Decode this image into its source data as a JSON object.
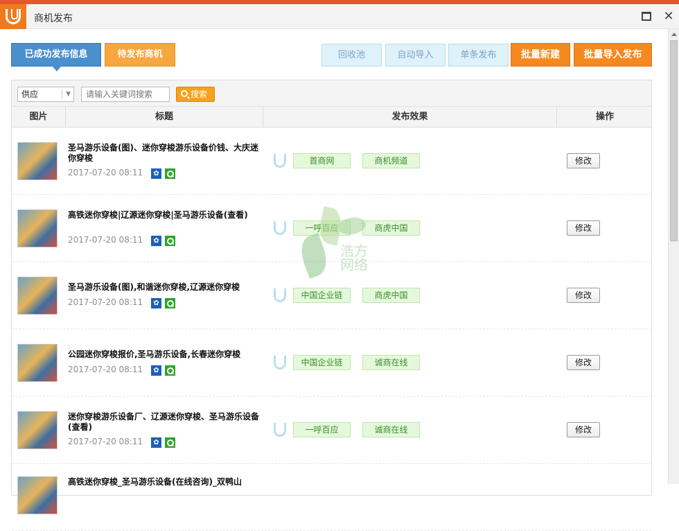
{
  "window": {
    "title": "商机发布"
  },
  "tabs": [
    {
      "label": "已成功发布信息",
      "active": true
    },
    {
      "label": "待发布商机",
      "active": false
    }
  ],
  "toolbar": {
    "recycle_label": "回收池",
    "auto_import_label": "自动导入",
    "single_publish_label": "单条发布",
    "batch_new_label": "批量新建",
    "batch_import_label": "批量导入发布"
  },
  "filter": {
    "category_value": "供应",
    "search_placeholder": "请输入关键词搜索",
    "search_button_label": "搜索"
  },
  "table": {
    "columns": [
      "图片",
      "标题",
      "发布效果",
      "操作"
    ],
    "rows": [
      {
        "title": "圣马游乐设备(图)、迷你穿梭游乐设备价钱、大庆迷你穿梭",
        "date": "2017-07-20 08:11",
        "sites": [
          "首商网",
          "商机频道"
        ],
        "action": "修改"
      },
      {
        "title": "高铁迷你穿梭|辽源迷你穿梭|圣马游乐设备(查看)",
        "date": "2017-07-20 08:11",
        "sites": [
          "一呼百应",
          "商虎中国"
        ],
        "action": "修改"
      },
      {
        "title": "圣马游乐设备(图),和谐迷你穿梭,辽源迷你穿梭",
        "date": "2017-07-20 08:11",
        "sites": [
          "中国企业链",
          "商虎中国"
        ],
        "action": "修改"
      },
      {
        "title": "公园迷你穿梭报价,圣马游乐设备,长春迷你穿梭",
        "date": "2017-07-20 08:11",
        "sites": [
          "中国企业链",
          "诚商在线"
        ],
        "action": "修改"
      },
      {
        "title": "迷你穿梭游乐设备厂、辽源迷你穿梭、圣马游乐设备(查看)",
        "date": "2017-07-20 08:11",
        "sites": [
          "一呼百应",
          "诚商在线"
        ],
        "action": "修改"
      },
      {
        "title": "高铁迷你穿梭_圣马游乐设备(在线咨询)_双鸭山",
        "date": "",
        "sites": [],
        "action": ""
      }
    ]
  },
  "watermark": {
    "text_line1": "浩方",
    "text_line2": "网络"
  },
  "colors": {
    "accent_blue": "#4b8fcd",
    "accent_orange": "#f5891f",
    "tag_green": "#e5f8dc"
  }
}
